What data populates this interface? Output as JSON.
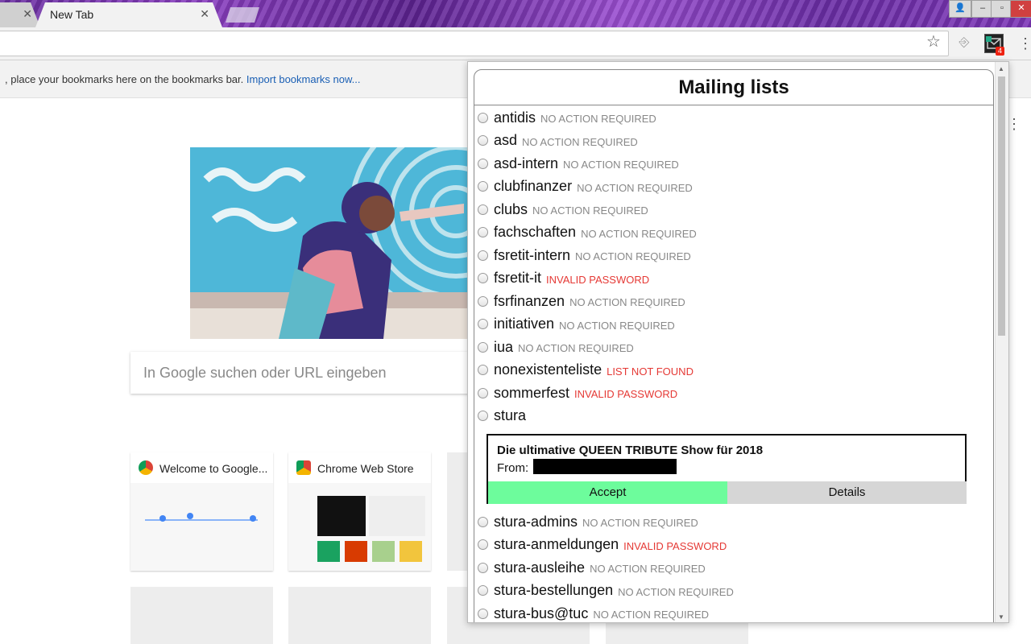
{
  "browser": {
    "active_tab_title": "New Tab",
    "close_glyph": "✕",
    "bookmark_bar_message": ", place your bookmarks here on the bookmarks bar.",
    "import_bookmarks_label": "Import bookmarks now...",
    "extension_badge": "4"
  },
  "ntp": {
    "search_placeholder": "In Google suchen oder URL eingeben",
    "tiles": [
      {
        "title": "Welcome to Google..."
      },
      {
        "title": "Chrome Web Store"
      }
    ]
  },
  "popup": {
    "title": "Mailing lists",
    "lists_before": [
      {
        "name": "antidis",
        "status": "NO ACTION REQUIRED",
        "error": false
      },
      {
        "name": "asd",
        "status": "NO ACTION REQUIRED",
        "error": false
      },
      {
        "name": "asd-intern",
        "status": "NO ACTION REQUIRED",
        "error": false
      },
      {
        "name": "clubfinanzer",
        "status": "NO ACTION REQUIRED",
        "error": false
      },
      {
        "name": "clubs",
        "status": "NO ACTION REQUIRED",
        "error": false
      },
      {
        "name": "fachschaften",
        "status": "NO ACTION REQUIRED",
        "error": false
      },
      {
        "name": "fsretit-intern",
        "status": "NO ACTION REQUIRED",
        "error": false
      },
      {
        "name": "fsretit-it",
        "status": "INVALID PASSWORD",
        "error": true
      },
      {
        "name": "fsrfinanzen",
        "status": "NO ACTION REQUIRED",
        "error": false
      },
      {
        "name": "initiativen",
        "status": "NO ACTION REQUIRED",
        "error": false
      },
      {
        "name": "iua",
        "status": "NO ACTION REQUIRED",
        "error": false
      },
      {
        "name": "nonexistenteliste",
        "status": "LIST NOT FOUND",
        "error": true
      },
      {
        "name": "sommerfest",
        "status": "INVALID PASSWORD",
        "error": true
      },
      {
        "name": "stura",
        "status": "",
        "error": false
      }
    ],
    "moderation": {
      "subject": "Die ultimative QUEEN TRIBUTE Show für 2018",
      "from_label": "From:",
      "accept_label": "Accept",
      "details_label": "Details"
    },
    "lists_after": [
      {
        "name": "stura-admins",
        "status": "NO ACTION REQUIRED",
        "error": false
      },
      {
        "name": "stura-anmeldungen",
        "status": "INVALID PASSWORD",
        "error": true
      },
      {
        "name": "stura-ausleihe",
        "status": "NO ACTION REQUIRED",
        "error": false
      },
      {
        "name": "stura-bestellungen",
        "status": "NO ACTION REQUIRED",
        "error": false
      },
      {
        "name": "stura-bus@tuc",
        "status": "NO ACTION REQUIRED",
        "error": false
      }
    ]
  },
  "colors": {
    "error": "#e53935",
    "status_ok": "#888888",
    "accept": "#6dfc9c",
    "details": "#d6d6d6"
  }
}
